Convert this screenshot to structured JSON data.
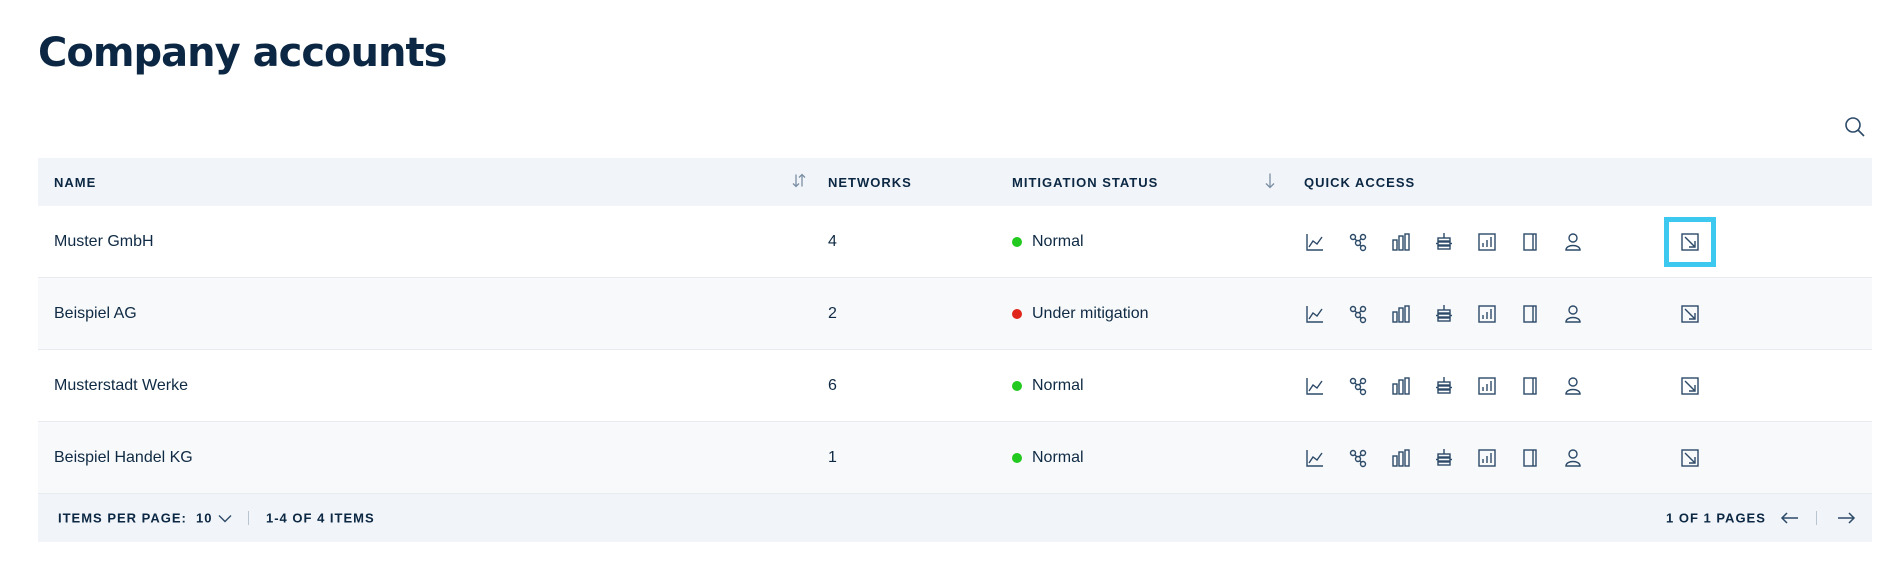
{
  "page": {
    "title": "Company accounts"
  },
  "search": {
    "icon": "search-icon"
  },
  "table": {
    "columns": {
      "name": "NAME",
      "networks": "NETWORKS",
      "mitigation_status": "MITIGATION STATUS",
      "quick_access": "QUICK ACCESS"
    },
    "rows": [
      {
        "name": "Muster GmbH",
        "networks": "4",
        "status": "Normal",
        "status_color": "#22c91e"
      },
      {
        "name": "Beispiel AG",
        "networks": "2",
        "status": "Under mitigation",
        "status_color": "#e0261b"
      },
      {
        "name": "Musterstadt Werke",
        "networks": "6",
        "status": "Normal",
        "status_color": "#22c91e"
      },
      {
        "name": "Beispiel Handel KG",
        "networks": "1",
        "status": "Normal",
        "status_color": "#22c91e"
      }
    ],
    "quick_access_icons": [
      "line-chart-icon",
      "network-nodes-icon",
      "bar-chart-icon",
      "server-stack-icon",
      "report-chart-icon",
      "document-icon",
      "user-icon"
    ],
    "open_icon": "open-external-icon"
  },
  "footer": {
    "items_per_page_label": "ITEMS PER PAGE:",
    "items_per_page_value": "10",
    "range_text": "1-4 OF 4 ITEMS",
    "pages_text": "1 OF 1 PAGES"
  },
  "colors": {
    "accent_focus": "#3cc8ef",
    "header_bg": "#f1f4f8",
    "title": "#0b2743"
  }
}
